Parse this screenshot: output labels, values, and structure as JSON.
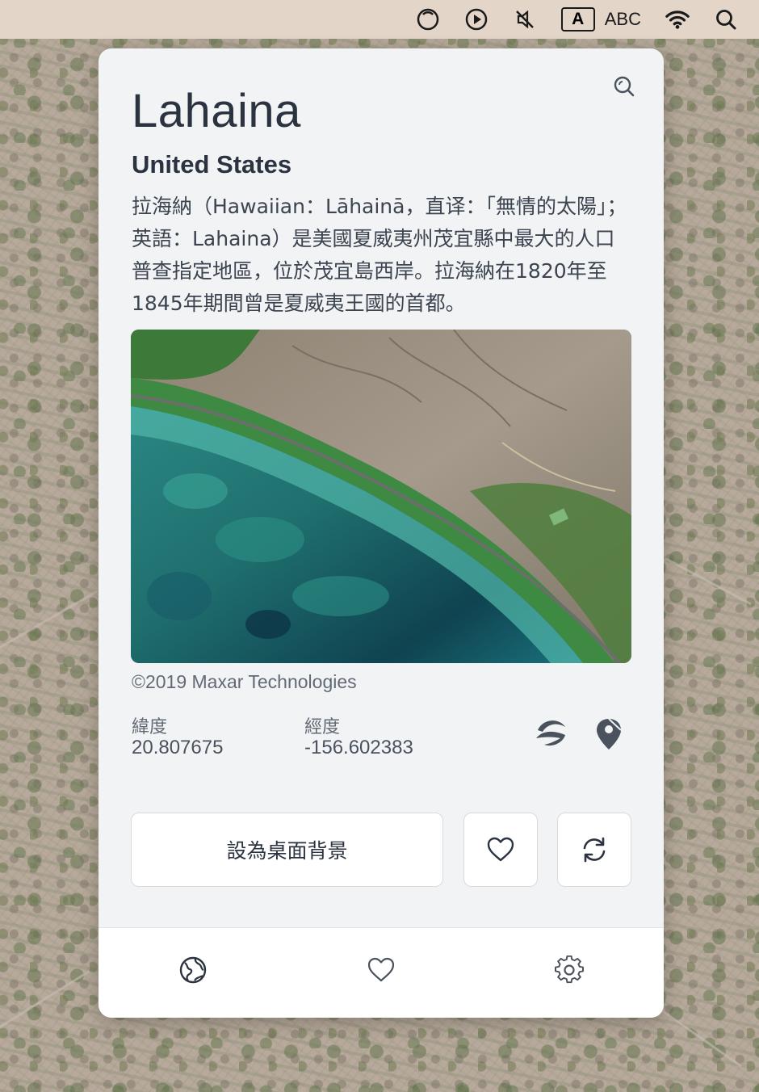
{
  "menubar": {
    "icons": [
      "circle-dashed-icon",
      "play-circle-icon",
      "mute-icon",
      "input-source-icon",
      "wifi-icon",
      "spotlight-search-icon"
    ],
    "input_badge": "A",
    "input_label": "ABC"
  },
  "panel": {
    "title": "Lahaina",
    "country": "United States",
    "description": "拉海納（Hawaiian：Lāhainā，直译：「無情的太陽」；英語：Lahaina）是美國夏威夷州茂宜縣中最大的人口普查指定地區，位於茂宜島西岸。拉海納在1820年至1845年期間曾是夏威夷王國的首都。",
    "credit": "©2019 Maxar Technologies",
    "latitude_label": "緯度",
    "latitude_value": "20.807675",
    "longitude_label": "經度",
    "longitude_value": "-156.602383",
    "set_wallpaper_label": "設為桌面背景",
    "icons": {
      "search": "zoom-search-icon",
      "earth": "google-earth-icon",
      "maps": "map-pin-icon",
      "favorite": "heart-icon",
      "refresh": "refresh-icon"
    }
  },
  "tabbar": {
    "tabs": [
      "globe-tab",
      "favorites-tab",
      "settings-tab"
    ]
  },
  "colors": {
    "menubar_bg": "#e3d6c8",
    "panel_bg": "#f2f3f5",
    "text_dark": "#2b3340",
    "text_muted": "#626a75"
  }
}
